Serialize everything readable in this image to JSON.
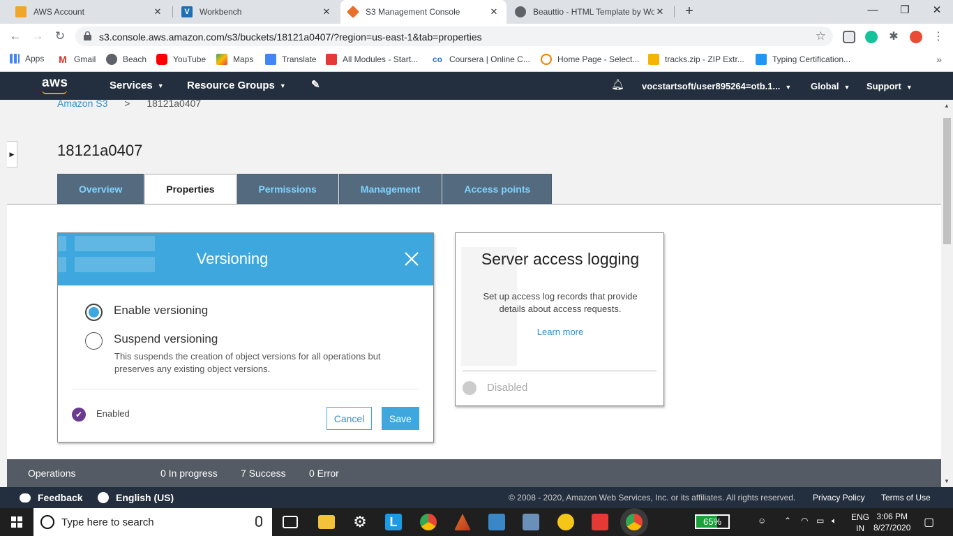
{
  "browser": {
    "tabs": [
      {
        "title": "AWS Account",
        "active": false,
        "color": "#f0a52b"
      },
      {
        "title": "Workbench",
        "active": false,
        "color": "#1f6fb5"
      },
      {
        "title": "S3 Management Console",
        "active": true,
        "color": "#e8702a"
      },
      {
        "title": "Beauttio - HTML Template by Wo",
        "active": false,
        "color": "#5f6368"
      }
    ],
    "new_tab": "+",
    "url": "s3.console.aws.amazon.com/s3/buckets/18121a0407/?region=us-east-1&tab=properties",
    "bookmarks": [
      "Apps",
      "Gmail",
      "Beach",
      "YouTube",
      "Maps",
      "Translate",
      "All Modules - Start...",
      "Coursera | Online C...",
      "Home Page - Select...",
      "tracks.zip - ZIP Extr...",
      "Typing Certification..."
    ]
  },
  "aws_header": {
    "logo": "aws",
    "services": "Services",
    "resource_groups": "Resource Groups",
    "account": "vocstartsoft/user895264=otb.1...",
    "region": "Global",
    "support": "Support"
  },
  "breadcrumb": {
    "root": "Amazon S3",
    "separator": ">",
    "current": "18121a0407"
  },
  "bucket_title": "18121a0407",
  "tabs": [
    "Overview",
    "Properties",
    "Permissions",
    "Management",
    "Access points"
  ],
  "versioning": {
    "title": "Versioning",
    "enable_label": "Enable versioning",
    "suspend_label": "Suspend versioning",
    "suspend_desc": "This suspends the creation of object versions for all operations but preserves any existing object versions.",
    "status": "Enabled",
    "cancel": "Cancel",
    "save": "Save",
    "selected": "enable"
  },
  "logging": {
    "title": "Server access logging",
    "desc": "Set up access log records that provide details about access requests.",
    "learn_more": "Learn more",
    "status": "Disabled"
  },
  "operations": {
    "label": "Operations",
    "in_progress": "0 In progress",
    "success": "7 Success",
    "error": "0 Error"
  },
  "footer": {
    "feedback": "Feedback",
    "language": "English (US)",
    "copyright": "© 2008 - 2020, Amazon Web Services, Inc. or its affiliates. All rights reserved.",
    "privacy": "Privacy Policy",
    "terms": "Terms of Use"
  },
  "taskbar": {
    "search_placeholder": "Type here to search",
    "battery": "65%",
    "battery_level": 0.65,
    "lang": "ENG",
    "lang_region": "IN",
    "time": "3:06 PM",
    "date": "8/27/2020"
  }
}
